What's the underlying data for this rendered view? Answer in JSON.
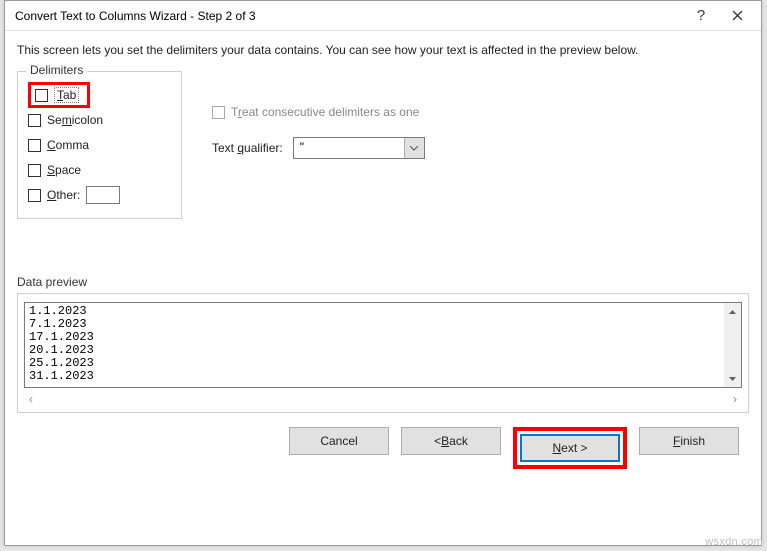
{
  "window": {
    "title": "Convert Text to Columns Wizard - Step 2 of 3",
    "help_icon": "?",
    "close_icon": "close-icon"
  },
  "description": "This screen lets you set the delimiters your data contains.  You can see how your text is affected in the preview below.",
  "delimiters": {
    "legend": "Delimiters",
    "tab": "Tab",
    "semicolon": "Semicolon",
    "comma": "Comma",
    "space": "Space",
    "other": "Other:",
    "other_value": ""
  },
  "options": {
    "treat_consecutive": "Treat consecutive delimiters as one",
    "qualifier_label": "Text qualifier:",
    "qualifier_value": "\""
  },
  "preview": {
    "legend": "Data preview",
    "lines": [
      "1.1.2023",
      "7.1.2023",
      "17.1.2023",
      "20.1.2023",
      "25.1.2023",
      "31.1.2023"
    ]
  },
  "buttons": {
    "cancel": "Cancel",
    "back": "< Back",
    "next": "Next >",
    "finish": "Finish"
  },
  "watermark": "wsxdn.com"
}
